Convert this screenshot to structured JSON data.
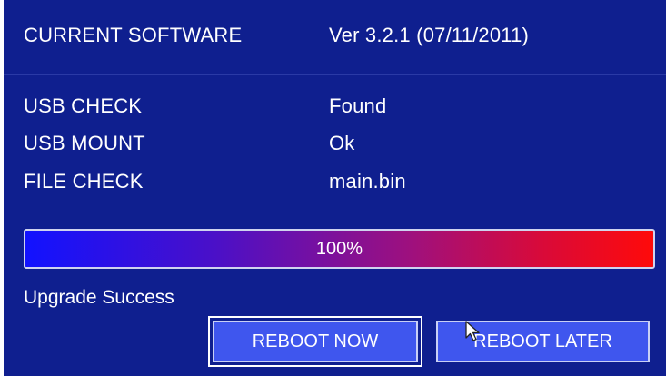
{
  "software": {
    "label": "CURRENT SOFTWARE",
    "value": "Ver 3.2.1 (07/11/2011)"
  },
  "checks": [
    {
      "label": "USB CHECK",
      "value": "Found"
    },
    {
      "label": "USB MOUNT",
      "value": "Ok"
    },
    {
      "label": "FILE CHECK",
      "value": "main.bin"
    }
  ],
  "progress": {
    "percent": 100,
    "text": "100%"
  },
  "status": "Upgrade Success",
  "buttons": {
    "reboot_now": "REBOOT NOW",
    "reboot_later": "REBOOT LATER"
  },
  "colors": {
    "background": "#0f1f8f",
    "progress_start": "#1212ff",
    "progress_end": "#ff0a0a",
    "button": "#3f56ee"
  },
  "icons": {
    "cursor": "mouse-pointer-icon"
  }
}
